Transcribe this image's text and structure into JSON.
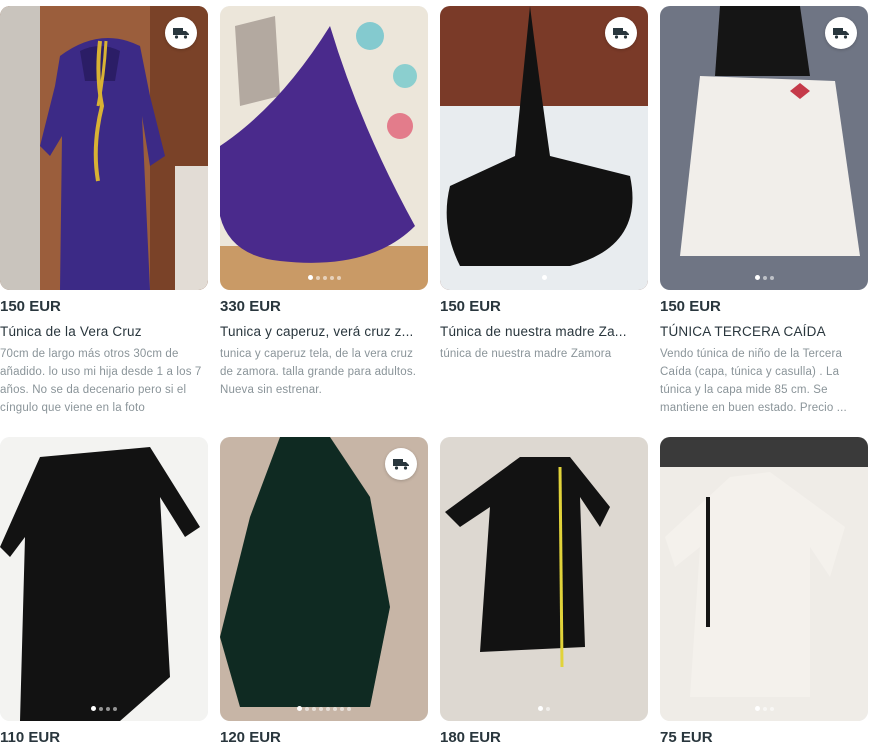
{
  "colors": {
    "price": "#29363d",
    "description": "#8a9499",
    "badge_bg": "#ffffff",
    "badge_icon": "#29363d"
  },
  "listings": [
    {
      "price": "150 EUR",
      "title": "Túnica de la Vera Cruz",
      "description": "70cm de largo más otros 30cm de añadido. lo uso mi hija desde 1 a los 7 años. No se da decenario pero si el cíngulo que viene en la foto",
      "shipping_icon": "truck-icon"
    },
    {
      "price": "330 EUR",
      "title": "Tunica y caperuz, verá cruz z...",
      "description": "tunica y caperuz tela, de la vera cruz de zamora. talla grande para adultos. Nueva sin estrenar.",
      "shipping_icon": ""
    },
    {
      "price": "150 EUR",
      "title": "Túnica de nuestra madre Za...",
      "description": "túnica de nuestra madre Zamora",
      "shipping_icon": "truck-icon"
    },
    {
      "price": "150 EUR",
      "title": "TÚNICA TERCERA CAÍDA",
      "description": "Vendo túnica de niño de la Tercera Caída (capa, túnica y casulla) . La túnica y la capa mide 85 cm. Se mantiene en buen estado. Precio ...",
      "shipping_icon": "truck-icon"
    },
    {
      "price": "110 EUR",
      "title": "",
      "description": "",
      "shipping_icon": ""
    },
    {
      "price": "120 EUR",
      "title": "",
      "description": "",
      "shipping_icon": "truck-icon"
    },
    {
      "price": "180 EUR",
      "title": "",
      "description": "",
      "shipping_icon": ""
    },
    {
      "price": "75 EUR",
      "title": "",
      "description": "",
      "shipping_icon": ""
    }
  ]
}
